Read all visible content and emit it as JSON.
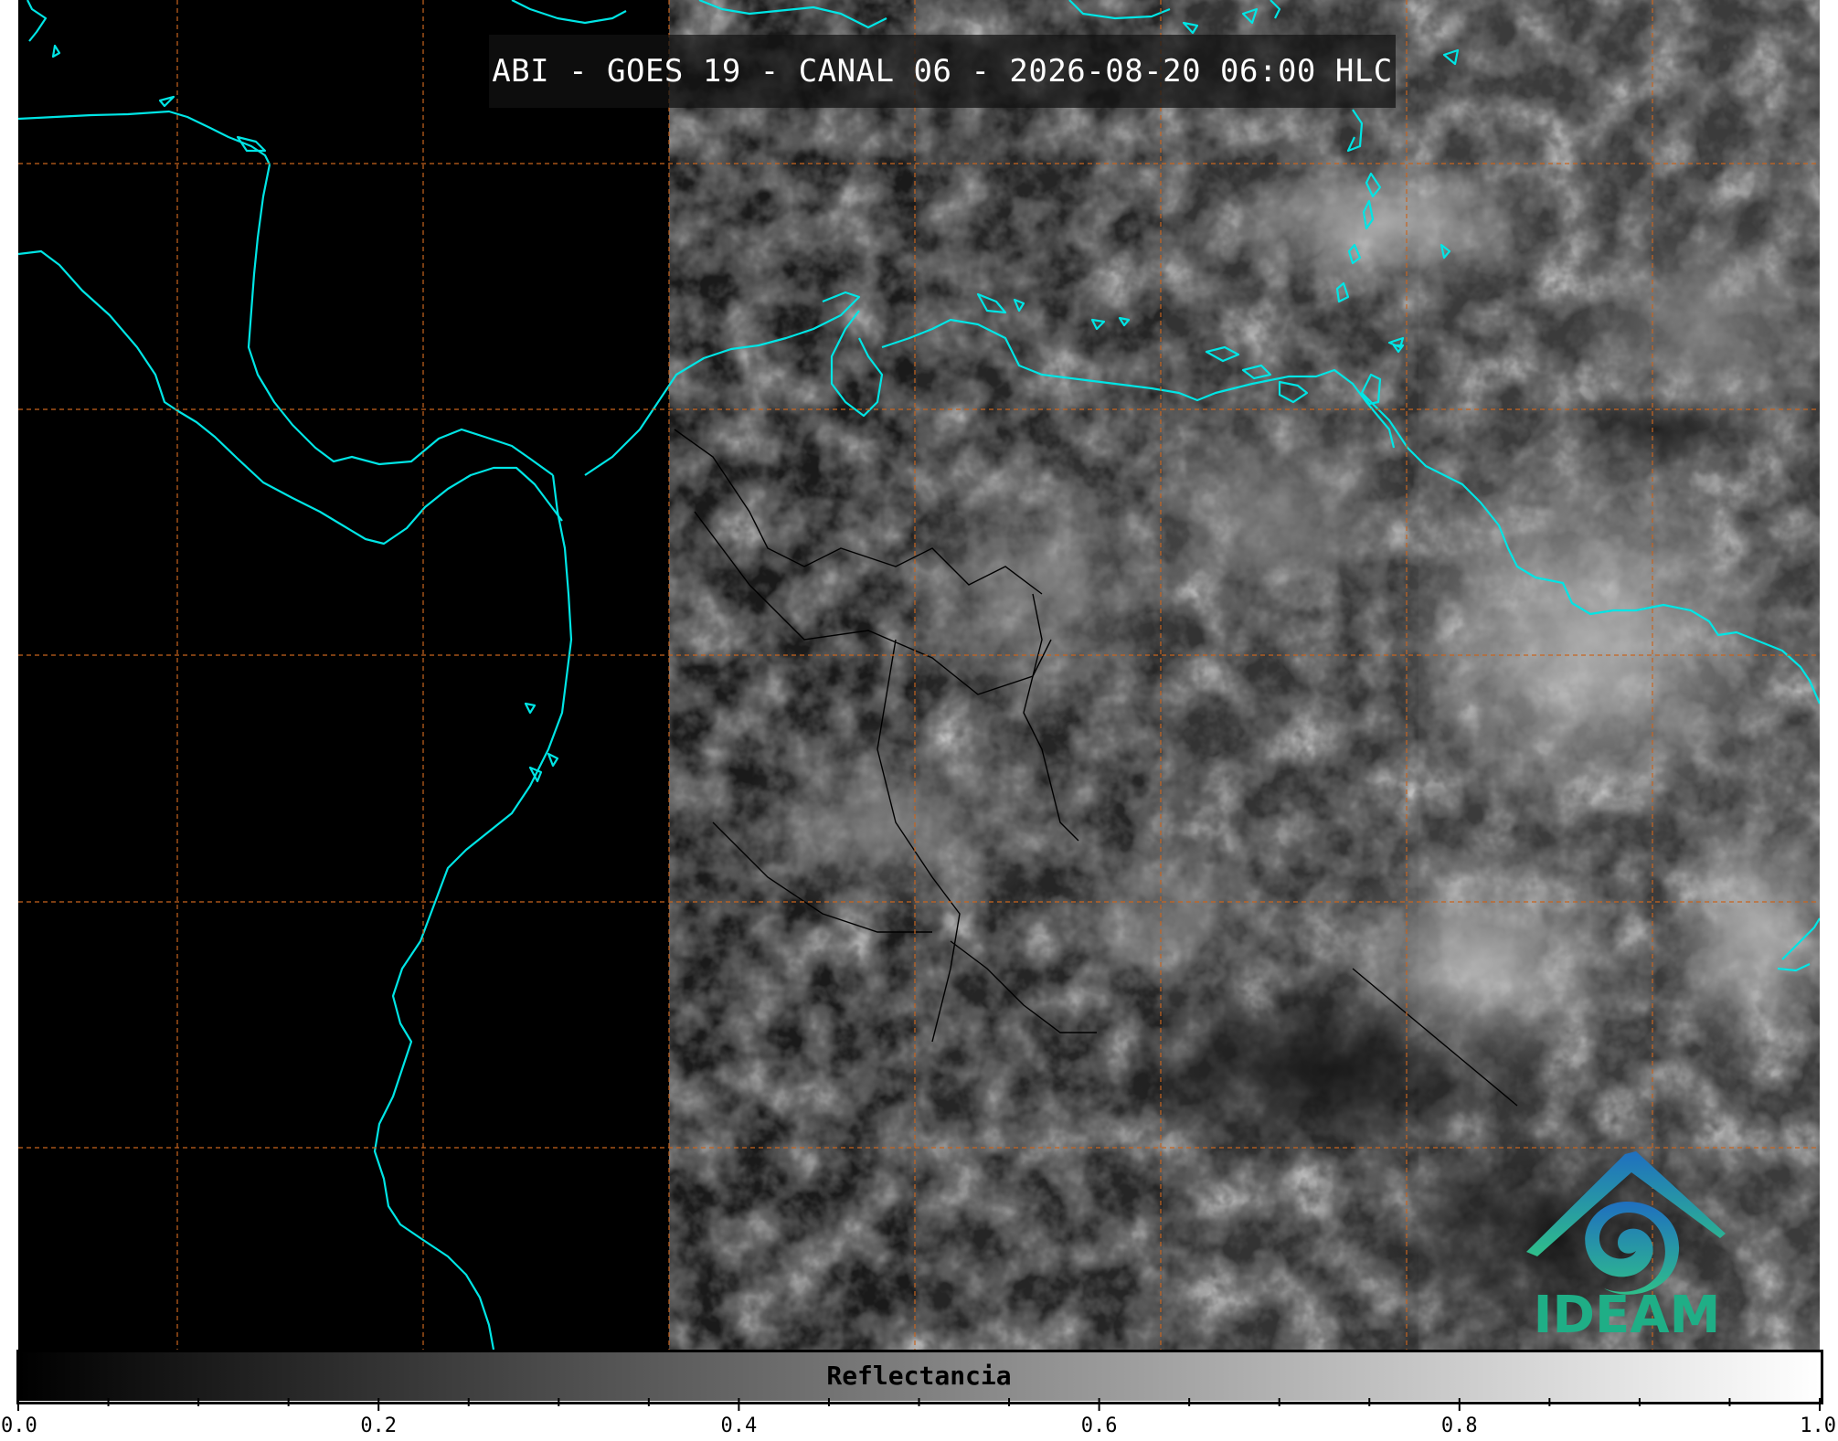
{
  "title": "ABI - GOES 19 - CANAL 06 - 2026-08-20 06:00 HLC",
  "logo": {
    "text": "IDEAM",
    "icon": "ideam-logo-icon"
  },
  "colorbar": {
    "label": "Reflectancia",
    "min": 0.0,
    "max": 1.0,
    "tick_labels": [
      "0.0",
      "0.2",
      "0.4",
      "0.6",
      "0.8",
      "1.0"
    ],
    "minor_tick_step": 0.05,
    "colormap": [
      "#000000",
      "#ffffff"
    ]
  },
  "map": {
    "coastline_color": "#00e5e5",
    "grid_color": "#c8641e",
    "grid_style": "dashed",
    "border_color": "#000000"
  }
}
